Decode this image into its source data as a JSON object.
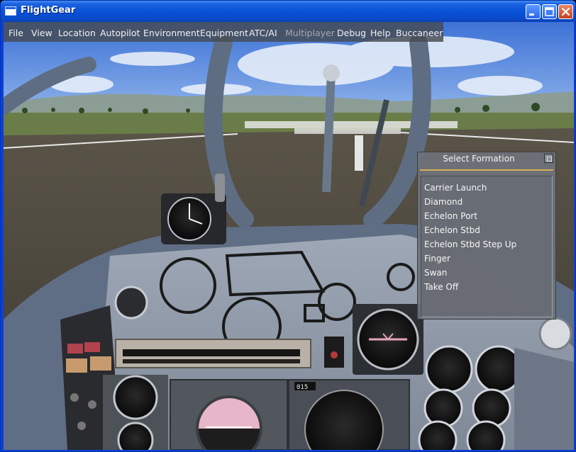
{
  "window": {
    "title": "FlightGear"
  },
  "menubar": {
    "items": [
      "File",
      "View",
      "Location",
      "Autopilot",
      "Environment",
      "Equipment",
      "ATC/AI",
      "Multiplayer",
      "Debug",
      "Help",
      "Buccaneer"
    ]
  },
  "dialog": {
    "title": "Select Formation",
    "items": [
      "Carrier Launch",
      "Diamond",
      "Echelon Port",
      "Echelon Stbd",
      "Echelon Stbd Step Up",
      "Finger",
      "Swan",
      "Take Off"
    ]
  },
  "cockpit": {
    "counter_label": "015"
  }
}
